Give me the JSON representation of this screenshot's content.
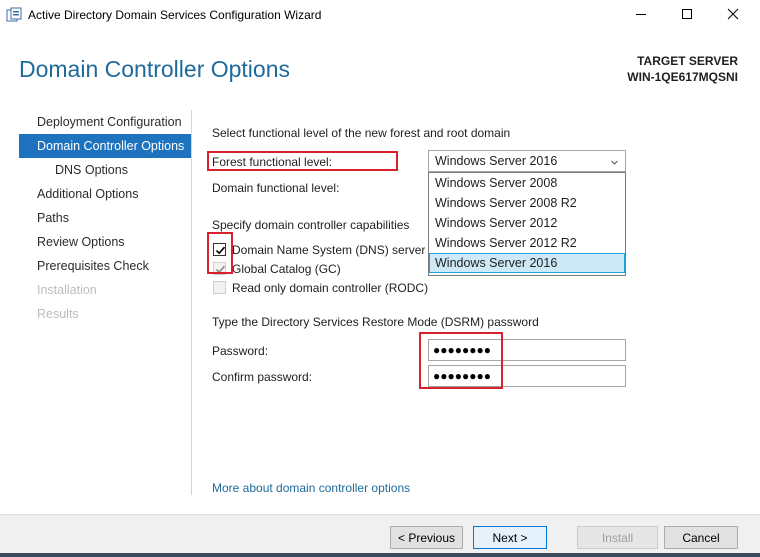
{
  "window": {
    "title": "Active Directory Domain Services Configuration Wizard"
  },
  "header": {
    "page_title": "Domain Controller Options",
    "target_label": "TARGET SERVER",
    "target_name": "WIN-1QE617MQSNI"
  },
  "nav": {
    "items": [
      {
        "label": "Deployment Configuration",
        "state": "normal"
      },
      {
        "label": "Domain Controller Options",
        "state": "active"
      },
      {
        "label": "DNS Options",
        "state": "sub"
      },
      {
        "label": "Additional Options",
        "state": "normal"
      },
      {
        "label": "Paths",
        "state": "normal"
      },
      {
        "label": "Review Options",
        "state": "normal"
      },
      {
        "label": "Prerequisites Check",
        "state": "normal"
      },
      {
        "label": "Installation",
        "state": "disabled"
      },
      {
        "label": "Results",
        "state": "disabled"
      }
    ]
  },
  "main": {
    "functional_heading": "Select functional level of the new forest and root domain",
    "forest_label": "Forest functional level:",
    "domain_label": "Domain functional level:",
    "forest_select": {
      "value": "Windows Server 2016",
      "options": [
        "Windows Server 2008",
        "Windows Server 2008 R2",
        "Windows Server 2012",
        "Windows Server 2012 R2",
        "Windows Server 2016"
      ],
      "selected_index": 4
    },
    "capabilities_heading": "Specify domain controller capabilities",
    "capabilities": {
      "dns": {
        "label": "Domain Name System (DNS) server",
        "checked": true,
        "enabled": true
      },
      "gc": {
        "label": "Global Catalog (GC)",
        "checked": true,
        "enabled": false
      },
      "rodc": {
        "label": "Read only domain controller (RODC)",
        "checked": false,
        "enabled": false
      }
    },
    "dsrm_heading": "Type the Directory Services Restore Mode (DSRM) password",
    "password_label": "Password:",
    "password_value": "●●●●●●●●",
    "confirm_label": "Confirm password:",
    "confirm_value": "●●●●●●●●",
    "more_link": "More about domain controller options"
  },
  "footer": {
    "previous": "< Previous",
    "next": "Next >",
    "install": "Install",
    "cancel": "Cancel"
  },
  "colors": {
    "accent": "#1e73be",
    "title_blue": "#1e6a9b",
    "highlight_red": "#d8212b",
    "dropdown_selected": "#cde8f7"
  },
  "icons": [
    "app-icon",
    "minimize-icon",
    "maximize-icon",
    "close-icon",
    "chevron-down-icon",
    "checkmark-icon"
  ]
}
